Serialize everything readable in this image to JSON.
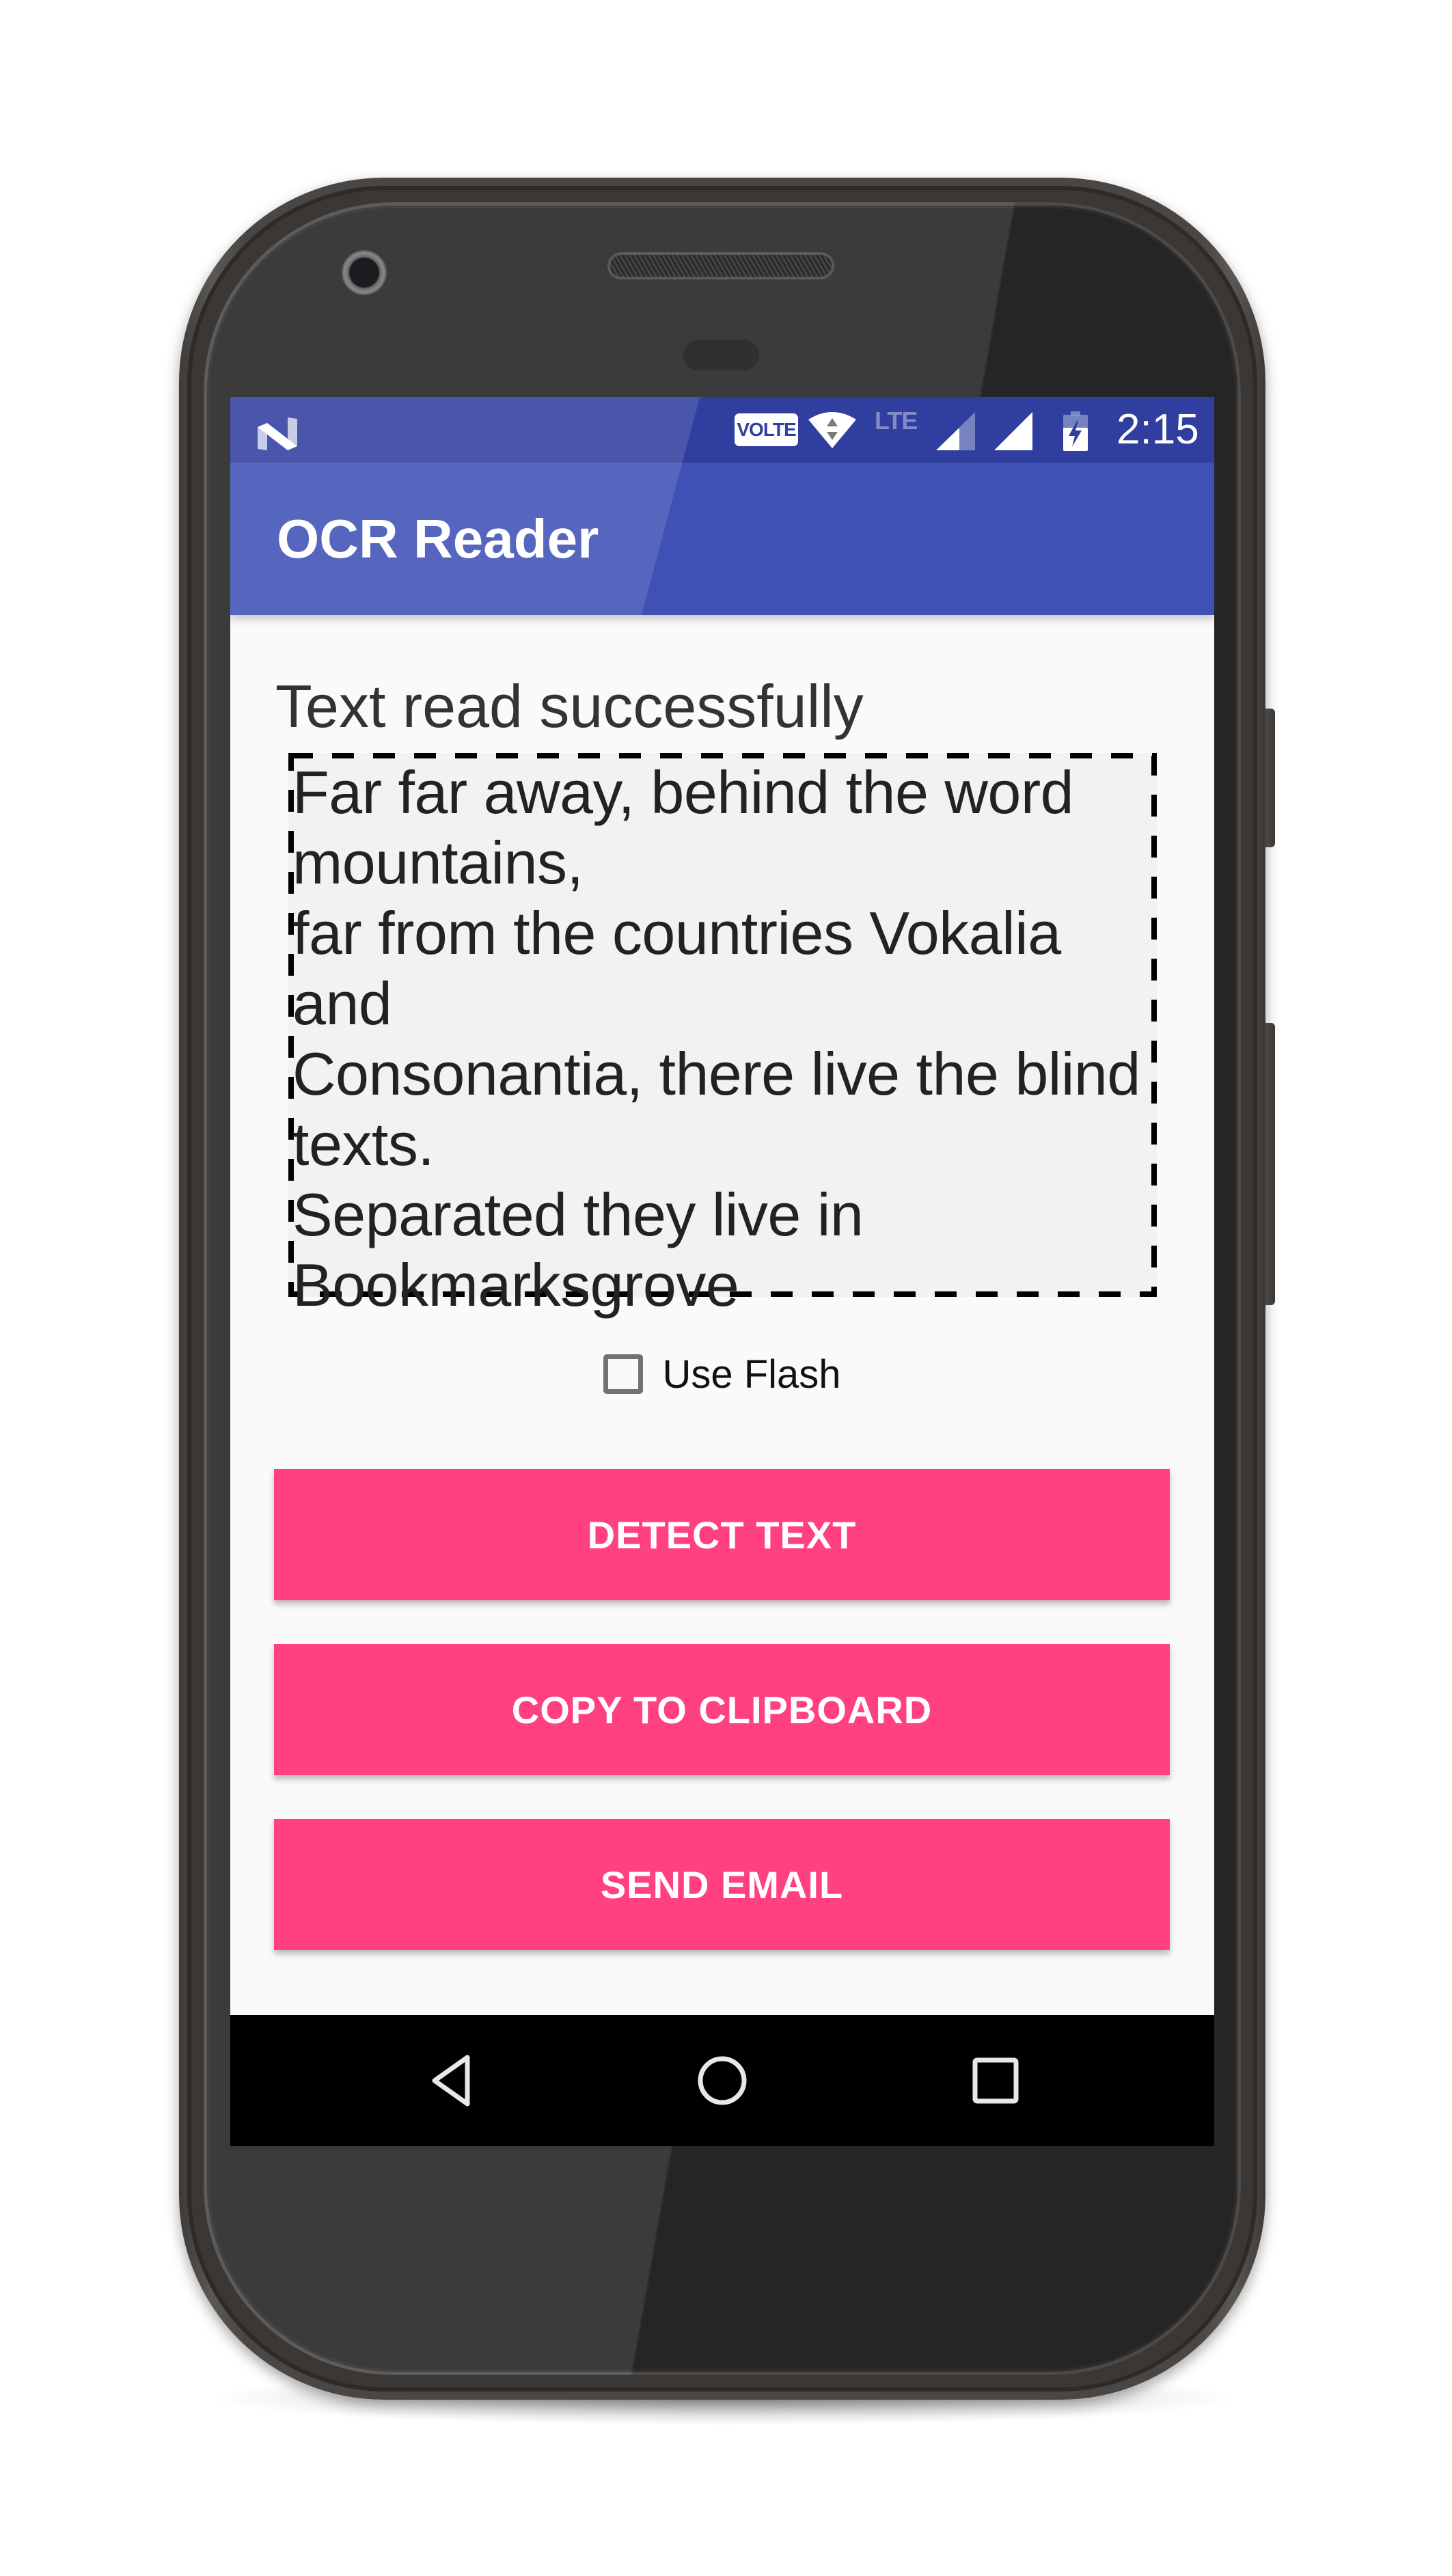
{
  "device": {
    "model_style": "android-phone"
  },
  "status_bar": {
    "notification_icon": "android-n-icon",
    "volte_label": "VOLTE",
    "wifi_icon": "wifi-data-icon",
    "network_label": "LTE",
    "signal_icons": [
      "signal-sim1-icon",
      "signal-sim2-icon"
    ],
    "battery_icon": "battery-charging-icon",
    "time": "2:15"
  },
  "app_bar": {
    "title": "OCR Reader"
  },
  "content": {
    "status_message": "Text read successfully",
    "ocr_text": "Far far away, behind the word mountains,\nfar from the countries Vokalia and\nConsonantia, there live the blind texts.\nSeparated they live in Bookmarksgrove",
    "use_flash": {
      "label": "Use Flash",
      "checked": false
    }
  },
  "buttons": {
    "detect": "DETECT TEXT",
    "copy": "COPY TO CLIPBOARD",
    "email": "SEND EMAIL"
  },
  "nav_bar": {
    "back": "back-icon",
    "home": "home-icon",
    "recents": "recents-icon"
  },
  "colors": {
    "primary": "#3F51B5",
    "primary_dark": "#303F9F",
    "accent": "#FF4081",
    "background": "#FAFAFA",
    "text_box_fill": "#F2F2F2"
  }
}
